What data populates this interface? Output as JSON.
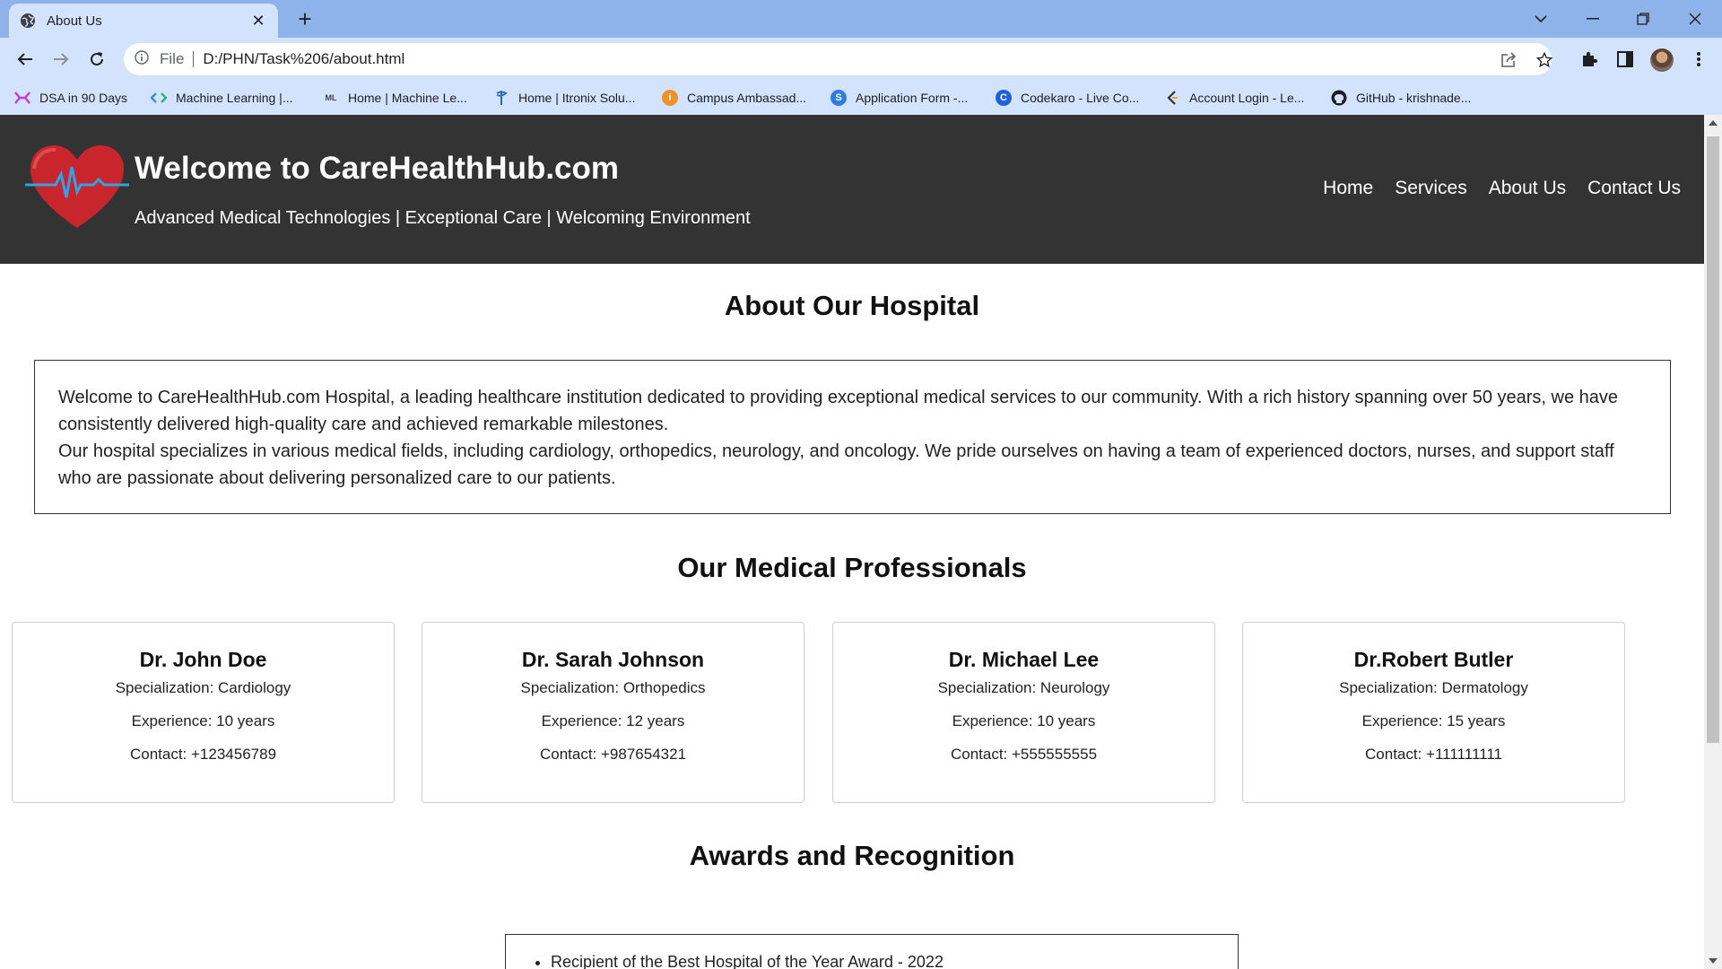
{
  "browser": {
    "tab_title": "About Us",
    "address_prefix": "File",
    "url": "D:/PHN/Task%206/about.html",
    "bookmarks": [
      {
        "label": "DSA in 90 Days",
        "icon": "dsa-icon",
        "color": "#c03fcf"
      },
      {
        "label": "Machine Learning |...",
        "icon": "code-icon",
        "color": "#3c8cd8"
      },
      {
        "label": "Home | Machine Le...",
        "icon": "ml-icon",
        "color": "#444444"
      },
      {
        "label": "Home | Itronix Solu...",
        "icon": "itronix-icon",
        "color": "#2a6db8"
      },
      {
        "label": "Campus Ambassad...",
        "icon": "campus-icon",
        "color": "#f0922a"
      },
      {
        "label": "Application Form -...",
        "icon": "s-icon",
        "color": "#2f7de1"
      },
      {
        "label": "Codekaro - Live Co...",
        "icon": "c-icon",
        "color": "#1f5fe0"
      },
      {
        "label": "Account Login - Le...",
        "icon": "leetcode-icon",
        "color": "#333333"
      },
      {
        "label": "GitHub - krishnade...",
        "icon": "github-icon",
        "color": "#1f1f1f"
      }
    ]
  },
  "site": {
    "title": "Welcome to CareHealthHub.com",
    "tagline": "Advanced Medical Technologies | Exceptional Care | Welcoming Environment",
    "nav": [
      "Home",
      "Services",
      "About Us",
      "Contact Us"
    ],
    "header_color": "#333333",
    "heart_color": "#c9252c",
    "pulse_color": "#2ea3e6"
  },
  "about": {
    "heading": "About Our Hospital",
    "paragraph1": "Welcome to CareHealthHub.com Hospital, a leading healthcare institution dedicated to providing exceptional medical services to our community. With a rich history spanning over 50 years, we have consistently delivered high-quality care and achieved remarkable milestones.",
    "paragraph2": "Our hospital specializes in various medical fields, including cardiology, orthopedics, neurology, and oncology. We pride ourselves on having a team of experienced doctors, nurses, and support staff who are passionate about delivering personalized care to our patients."
  },
  "professionals": {
    "heading": "Our Medical Professionals",
    "doctors": [
      {
        "name": "Dr. John Doe",
        "specialization": "Specialization: Cardiology",
        "experience": "Experience: 10 years",
        "contact": "Contact: +123456789"
      },
      {
        "name": "Dr. Sarah Johnson",
        "specialization": "Specialization: Orthopedics",
        "experience": "Experience: 12 years",
        "contact": "Contact: +987654321"
      },
      {
        "name": "Dr. Michael Lee",
        "specialization": "Specialization: Neurology",
        "experience": "Experience: 10 years",
        "contact": "Contact: +555555555"
      },
      {
        "name": "Dr.Robert Butler",
        "specialization": "Specialization: Dermatology",
        "experience": "Experience: 15 years",
        "contact": "Contact: +111111111"
      }
    ]
  },
  "awards": {
    "heading": "Awards and Recognition",
    "items": [
      "Recipient of the Best Hospital of the Year Award - 2022"
    ]
  }
}
